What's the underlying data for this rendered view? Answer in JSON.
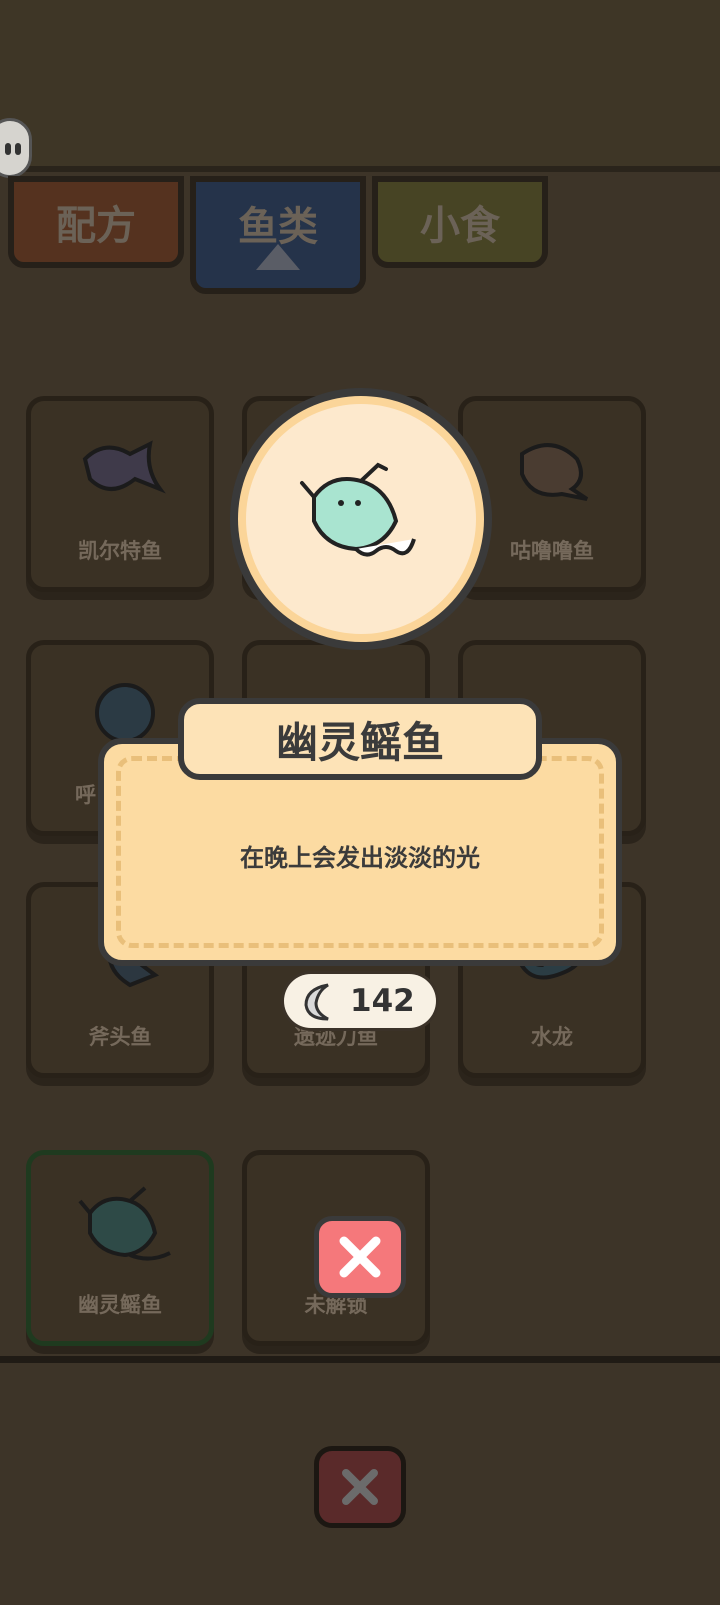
{
  "tabs": [
    {
      "label": "配方"
    },
    {
      "label": "鱼类"
    },
    {
      "label": "小食"
    }
  ],
  "fish_cards": [
    {
      "name": "凯尔特鱼"
    },
    {
      "name": ""
    },
    {
      "name": "咕噜噜鱼"
    },
    {
      "name": "呼"
    },
    {
      "name": ""
    },
    {
      "name": ""
    },
    {
      "name": "斧头鱼"
    },
    {
      "name": "遗迹刀鱼"
    },
    {
      "name": "水龙"
    },
    {
      "name": "幽灵鳐鱼"
    },
    {
      "name": "未解锁"
    }
  ],
  "detail": {
    "title": "幽灵鳐鱼",
    "description": "在晚上会发出淡淡的光",
    "price": "142"
  },
  "colors": {
    "panel": "#fcdba2",
    "close_button": "#f5787b",
    "fish_highlight": "#a9e4d0"
  }
}
